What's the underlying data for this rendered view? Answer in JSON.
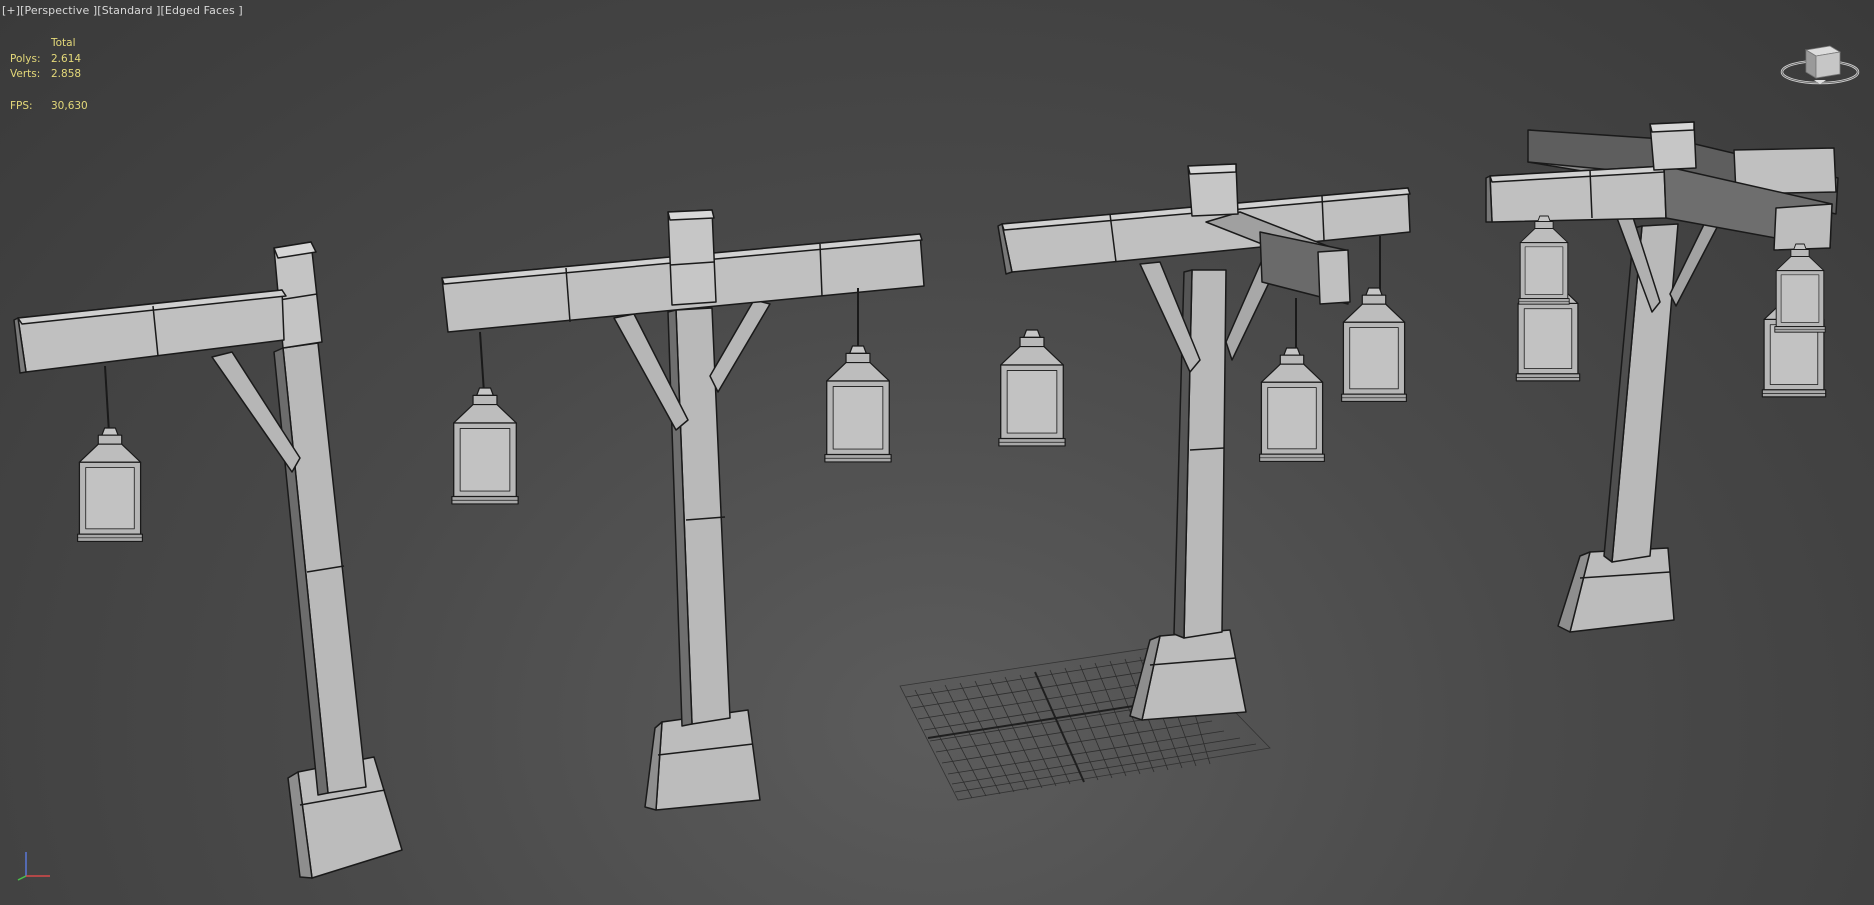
{
  "viewport": {
    "label_plus": "[+]",
    "label_view": "[Perspective ]",
    "label_shading": "[Standard ]",
    "label_edges": "[Edged Faces ]"
  },
  "stats": {
    "header": "Total",
    "polys_label": "Polys:",
    "polys_value": "2.614",
    "verts_label": "Verts:",
    "verts_value": "2.858",
    "fps_label": "FPS:",
    "fps_value": "30,630"
  },
  "colors": {
    "background": "#4a4a4a",
    "stats_text": "#e4d97a",
    "model_face": "#b4b4b4",
    "model_edge": "#1a1a1a",
    "grid": "#2e2e2e"
  },
  "icons": {
    "viewcube": "viewcube-icon",
    "axis": "axis-tripod-icon"
  }
}
